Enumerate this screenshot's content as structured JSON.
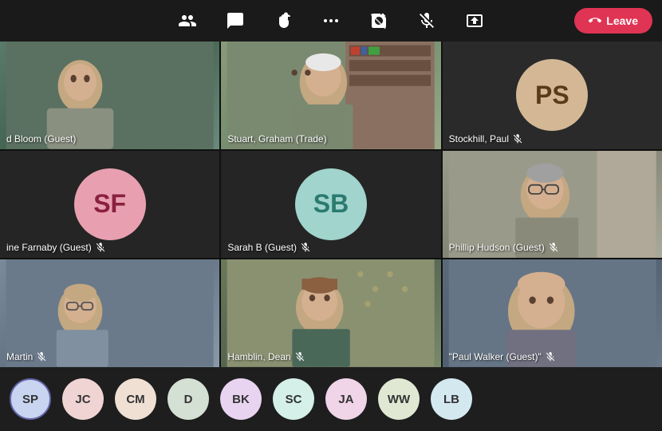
{
  "toolbar": {
    "icons": [
      "people",
      "chat",
      "hand",
      "more",
      "camera-off",
      "mic-off",
      "share"
    ],
    "leave_label": "Leave"
  },
  "participants": [
    {
      "id": "bloom",
      "name": "d Bloom (Guest)",
      "type": "video",
      "muted": false,
      "bg": "bloom"
    },
    {
      "id": "graham",
      "name": "Stuart, Graham (Trade)",
      "type": "video",
      "muted": false,
      "bg": "graham"
    },
    {
      "id": "stockhill",
      "name": "Stockhill, Paul",
      "type": "avatar",
      "initials": "PS",
      "muted": true,
      "avatarBg": "#d4b896",
      "textColor": "#5a3a1a"
    },
    {
      "id": "farnaby",
      "name": "ine Farnaby (Guest)",
      "type": "avatar",
      "initials": "SF",
      "muted": true,
      "avatarBg": "#e8a0b0",
      "textColor": "#8a2040"
    },
    {
      "id": "sarahb",
      "name": "Sarah B (Guest)",
      "type": "avatar",
      "initials": "SB",
      "muted": true,
      "avatarBg": "#a0d4cc",
      "textColor": "#2a7a70"
    },
    {
      "id": "phillip",
      "name": "Phillip Hudson (Guest)",
      "type": "video",
      "muted": true,
      "bg": "phillip"
    },
    {
      "id": "martin",
      "name": "Martin",
      "type": "video",
      "muted": true,
      "bg": "martin"
    },
    {
      "id": "hamblin",
      "name": "Hamblin, Dean",
      "type": "video",
      "muted": true,
      "bg": "hamblin"
    },
    {
      "id": "paulwalker",
      "name": "\"Paul Walker (Guest)\"",
      "type": "video",
      "muted": true,
      "bg": "paul"
    }
  ],
  "bottom_participants": [
    {
      "id": "sp",
      "initials": "SP",
      "bg": "#c8d4f0",
      "active": true
    },
    {
      "id": "jc",
      "initials": "JC",
      "bg": "#f0d4d4",
      "active": false
    },
    {
      "id": "cm",
      "initials": "CM",
      "bg": "#f0e0d4",
      "active": false
    },
    {
      "id": "d",
      "initials": "D",
      "bg": "#d4e0d4",
      "active": false
    },
    {
      "id": "bk",
      "initials": "BK",
      "bg": "#e8d4f0",
      "active": false
    },
    {
      "id": "sc",
      "initials": "SC",
      "bg": "#d4f0e8",
      "active": false
    },
    {
      "id": "ja",
      "initials": "JA",
      "bg": "#f0d4e8",
      "active": false
    },
    {
      "id": "ww",
      "initials": "WW",
      "bg": "#e0e8d4",
      "active": false
    },
    {
      "id": "lb",
      "initials": "LB",
      "bg": "#d4e8f0",
      "active": false
    }
  ]
}
